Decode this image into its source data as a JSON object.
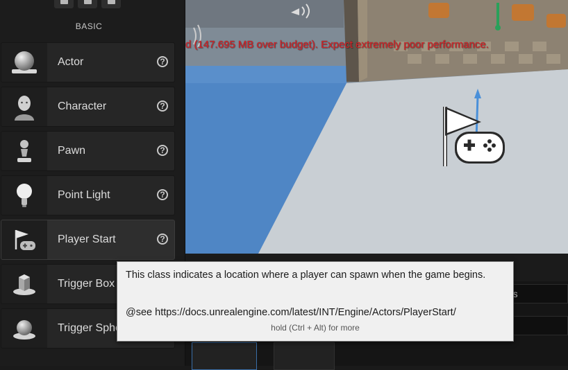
{
  "panel": {
    "section_label": "BASIC",
    "items": [
      {
        "label": "Actor",
        "icon": "sphere-actor-icon"
      },
      {
        "label": "Character",
        "icon": "character-head-icon"
      },
      {
        "label": "Pawn",
        "icon": "pawn-icon"
      },
      {
        "label": "Point Light",
        "icon": "light-bulb-icon"
      },
      {
        "label": "Player Start",
        "icon": "player-start-icon"
      },
      {
        "label": "Trigger Box",
        "icon": "trigger-box-icon"
      },
      {
        "label": "Trigger Sphere",
        "icon": "trigger-sphere-icon"
      }
    ],
    "help_glyph": "?"
  },
  "viewport": {
    "warning": "d (147.695 MB over budget). Expect extremely poor performance."
  },
  "details": {
    "partial_tab": "nts"
  },
  "tooltip": {
    "description": "This class indicates a location where a player can spawn when the game begins.",
    "see_link": "@see https://docs.unrealengine.com/latest/INT/Engine/Actors/PlayerStart/",
    "hint": "hold (Ctrl + Alt) for more"
  },
  "colors": {
    "warning_red": "#d3262b",
    "floor_blue": "#4f86c5",
    "floor_light": "#c9cfd4"
  }
}
